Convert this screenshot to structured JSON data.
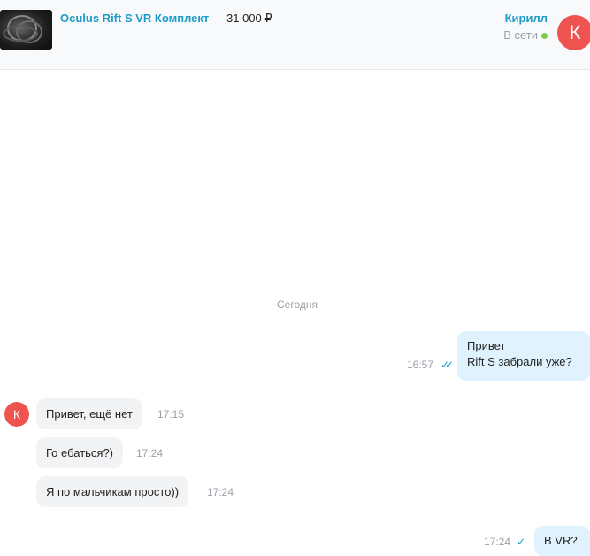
{
  "header": {
    "ad_title": "Oculus Rift S VR Комплект",
    "ad_price": "31 000 ₽",
    "user_name": "Кирилл",
    "user_status": "В сети",
    "avatar_letter": "К",
    "status_color": "#7cc94b"
  },
  "chat": {
    "date_separator": "Сегодня",
    "messages": [
      {
        "direction": "out",
        "lines": [
          "Привет",
          "Rift S забрали уже?"
        ],
        "time": "16:57",
        "status": "read"
      },
      {
        "direction": "in",
        "text": "Привет, ещё нет",
        "time": "17:15",
        "avatar_letter": "К"
      },
      {
        "direction": "in",
        "text": "Го ебаться?)",
        "time": "17:24"
      },
      {
        "direction": "in",
        "text": "Я по мальчикам просто))",
        "time": "17:24"
      },
      {
        "direction": "out",
        "text": "В VR?",
        "time": "17:24",
        "status": "sent"
      }
    ]
  },
  "icons": {
    "read_check": "✓✓",
    "sent_check": "✓"
  },
  "colors": {
    "accent": "#1f9bc9",
    "avatar": "#ef5350",
    "outgoing_bubble": "#dff2fd",
    "incoming_bubble": "#f2f3f5"
  }
}
